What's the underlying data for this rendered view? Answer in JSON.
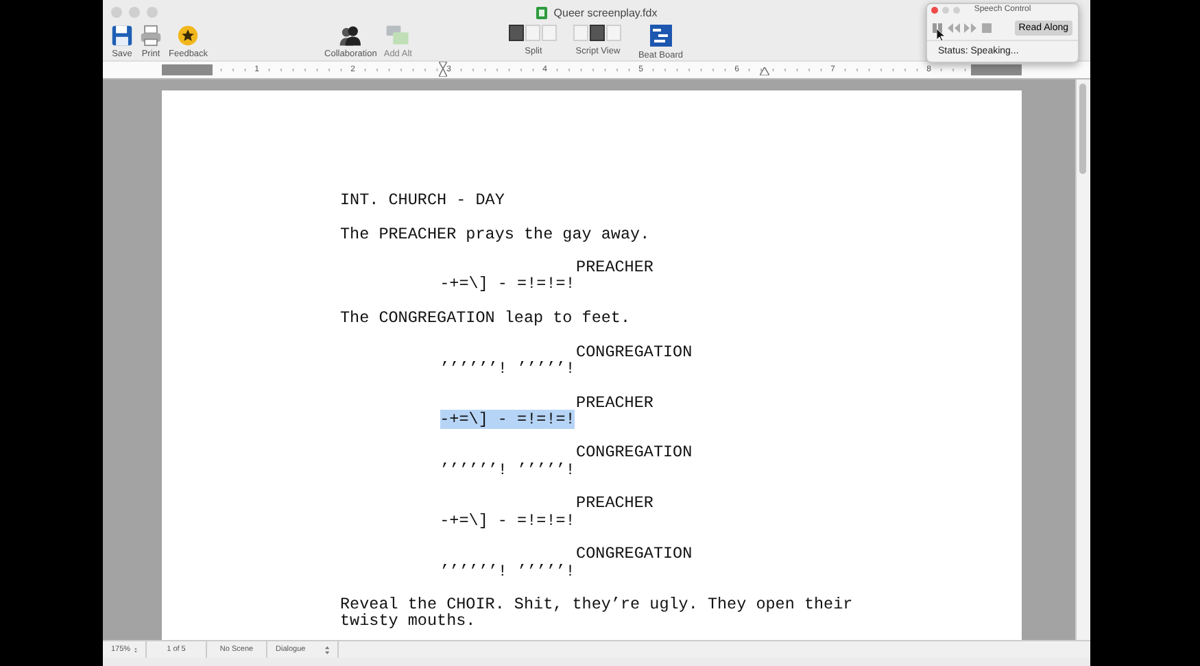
{
  "window": {
    "title": "Queer screenplay.fdx"
  },
  "toolbar": {
    "left": [
      {
        "kind": "save",
        "label": "Save"
      },
      {
        "kind": "print",
        "label": "Print"
      },
      {
        "kind": "feedback",
        "label": "Feedback"
      }
    ],
    "middle": [
      {
        "kind": "collaboration",
        "label": "Collaboration",
        "disabled": false
      },
      {
        "kind": "add_alt",
        "label": "Add Alt",
        "disabled": true
      }
    ],
    "split": {
      "label": "Split",
      "segments": [
        {
          "selected": true
        },
        {
          "selected": false
        },
        {
          "selected": false
        }
      ]
    },
    "script_view": {
      "label": "Script View",
      "segments": [
        {
          "selected": false
        },
        {
          "selected": true
        },
        {
          "selected": false
        }
      ]
    },
    "beat_board": {
      "label": "Beat Board"
    }
  },
  "ruler": {
    "labels": [
      "1",
      "2",
      "3",
      "4",
      "5",
      "6",
      "7",
      "8"
    ]
  },
  "script": [
    {
      "kind": "heading",
      "text": "INT. CHURCH - DAY",
      "selected": false
    },
    {
      "kind": "action",
      "text": "The PREACHER prays the gay away.",
      "selected": false
    },
    {
      "kind": "character",
      "text": "PREACHER",
      "selected": false
    },
    {
      "kind": "dialogue",
      "text": "-+=\\] - =!=!=!",
      "selected": false
    },
    {
      "kind": "action",
      "text": "The CONGREGATION leap to feet.",
      "selected": false
    },
    {
      "kind": "character",
      "text": "CONGREGATION",
      "selected": false
    },
    {
      "kind": "dialogue",
      "text": "’’’’’’! ’’’’’!",
      "selected": false
    },
    {
      "kind": "character",
      "text": "PREACHER",
      "selected": false
    },
    {
      "kind": "dialogue",
      "text": "-+=\\] - =!=!=!",
      "selected": true
    },
    {
      "kind": "character",
      "text": "CONGREGATION",
      "selected": false
    },
    {
      "kind": "dialogue",
      "text": "’’’’’’! ’’’’’!",
      "selected": false
    },
    {
      "kind": "character",
      "text": "PREACHER",
      "selected": false
    },
    {
      "kind": "dialogue",
      "text": "-+=\\] - =!=!=!",
      "selected": false
    },
    {
      "kind": "character",
      "text": "CONGREGATION",
      "selected": false
    },
    {
      "kind": "dialogue",
      "text": "’’’’’’! ’’’’’!",
      "selected": false
    },
    {
      "kind": "action",
      "text": "Reveal the CHOIR. Shit, they’re ugly. They open their twisty mouths.",
      "selected": false
    }
  ],
  "status_bar": {
    "zoom": "175%",
    "page": "1 of 5",
    "scene": "No Scene",
    "element": "Dialogue"
  },
  "speech_control": {
    "title": "Speech Control",
    "read_along": "Read Along",
    "status": "Status: Speaking..."
  }
}
